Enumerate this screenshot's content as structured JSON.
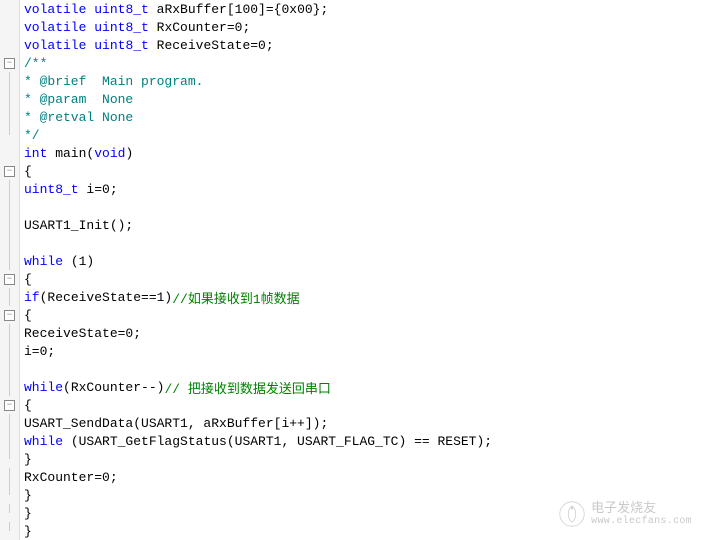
{
  "lines": [
    {
      "fold": "",
      "indent": "  ",
      "tokens": [
        {
          "c": "kw",
          "t": "volatile"
        },
        {
          "c": "",
          "t": " "
        },
        {
          "c": "type",
          "t": "uint8_t"
        },
        {
          "c": "",
          "t": " aRxBuffer[100]={0x00};"
        }
      ]
    },
    {
      "fold": "",
      "indent": "  ",
      "tokens": [
        {
          "c": "kw",
          "t": "volatile"
        },
        {
          "c": "",
          "t": " "
        },
        {
          "c": "type",
          "t": "uint8_t"
        },
        {
          "c": "",
          "t": " RxCounter=0;"
        }
      ]
    },
    {
      "fold": "",
      "indent": "  ",
      "tokens": [
        {
          "c": "kw",
          "t": "volatile"
        },
        {
          "c": "",
          "t": " "
        },
        {
          "c": "type",
          "t": "uint8_t"
        },
        {
          "c": "",
          "t": " ReceiveState=0;"
        }
      ]
    },
    {
      "fold": "minus",
      "indent": "",
      "tokens": [
        {
          "c": "doc-comment",
          "t": "/**"
        }
      ]
    },
    {
      "fold": "bar",
      "indent": "  ",
      "tokens": [
        {
          "c": "doc-comment",
          "t": "* @brief  Main program."
        }
      ]
    },
    {
      "fold": "bar",
      "indent": "  ",
      "tokens": [
        {
          "c": "doc-comment",
          "t": "* @param  None"
        }
      ]
    },
    {
      "fold": "bar",
      "indent": "  ",
      "tokens": [
        {
          "c": "doc-comment",
          "t": "* @retval None"
        }
      ]
    },
    {
      "fold": "end",
      "indent": "  ",
      "tokens": [
        {
          "c": "doc-comment",
          "t": "*/"
        }
      ]
    },
    {
      "fold": "",
      "indent": "",
      "tokens": [
        {
          "c": "kw",
          "t": "int"
        },
        {
          "c": "",
          "t": " main("
        },
        {
          "c": "kw",
          "t": "void"
        },
        {
          "c": "",
          "t": ")"
        }
      ]
    },
    {
      "fold": "minus",
      "indent": "",
      "tokens": [
        {
          "c": "",
          "t": "{"
        }
      ]
    },
    {
      "fold": "bar",
      "indent": "   ",
      "tokens": [
        {
          "c": "type",
          "t": "uint8_t"
        },
        {
          "c": "",
          "t": " i=0;"
        }
      ]
    },
    {
      "fold": "bar",
      "indent": "",
      "tokens": []
    },
    {
      "fold": "bar",
      "indent": "   ",
      "tokens": [
        {
          "c": "",
          "t": "USART1_Init();"
        }
      ]
    },
    {
      "fold": "bar",
      "indent": "",
      "tokens": []
    },
    {
      "fold": "bar",
      "indent": "   ",
      "tokens": [
        {
          "c": "kw",
          "t": "while"
        },
        {
          "c": "",
          "t": " (1)"
        }
      ]
    },
    {
      "fold": "minus",
      "indent": "   ",
      "tokens": [
        {
          "c": "",
          "t": "{"
        }
      ]
    },
    {
      "fold": "bar",
      "indent": "     ",
      "tokens": [
        {
          "c": "kw",
          "t": "if"
        },
        {
          "c": "",
          "t": "(ReceiveState==1)"
        },
        {
          "c": "comment-green",
          "t": "//如果接收到1帧数据"
        }
      ]
    },
    {
      "fold": "minus",
      "indent": "     ",
      "tokens": [
        {
          "c": "",
          "t": "{"
        }
      ]
    },
    {
      "fold": "bar",
      "indent": "       ",
      "tokens": [
        {
          "c": "",
          "t": "ReceiveState=0;"
        }
      ]
    },
    {
      "fold": "bar",
      "indent": "       ",
      "tokens": [
        {
          "c": "",
          "t": "i=0;"
        }
      ]
    },
    {
      "fold": "bar",
      "indent": "",
      "tokens": []
    },
    {
      "fold": "bar",
      "indent": "       ",
      "tokens": [
        {
          "c": "kw",
          "t": "while"
        },
        {
          "c": "",
          "t": "(RxCounter--)"
        },
        {
          "c": "comment-green",
          "t": "// 把接收到数据发送回串口"
        }
      ]
    },
    {
      "fold": "minus",
      "indent": "       ",
      "tokens": [
        {
          "c": "",
          "t": "{"
        }
      ]
    },
    {
      "fold": "bar",
      "indent": "         ",
      "tokens": [
        {
          "c": "",
          "t": "USART_SendData(USART1, aRxBuffer[i++]);"
        }
      ]
    },
    {
      "fold": "bar",
      "indent": "         ",
      "tokens": [
        {
          "c": "kw",
          "t": "while"
        },
        {
          "c": "",
          "t": " (USART_GetFlagStatus(USART1, USART_FLAG_TC) == RESET);"
        }
      ]
    },
    {
      "fold": "end",
      "indent": "       ",
      "tokens": [
        {
          "c": "",
          "t": "}"
        }
      ]
    },
    {
      "fold": "bar",
      "indent": "       ",
      "tokens": [
        {
          "c": "",
          "t": "RxCounter=0;"
        }
      ]
    },
    {
      "fold": "end",
      "indent": "     ",
      "tokens": [
        {
          "c": "",
          "t": "}"
        }
      ]
    },
    {
      "fold": "end",
      "indent": "   ",
      "tokens": [
        {
          "c": "",
          "t": "}"
        }
      ]
    },
    {
      "fold": "end",
      "indent": "",
      "tokens": [
        {
          "c": "",
          "t": "}"
        }
      ]
    }
  ],
  "watermark": {
    "cn": "电子发烧友",
    "url": "www.elecfans.com"
  }
}
